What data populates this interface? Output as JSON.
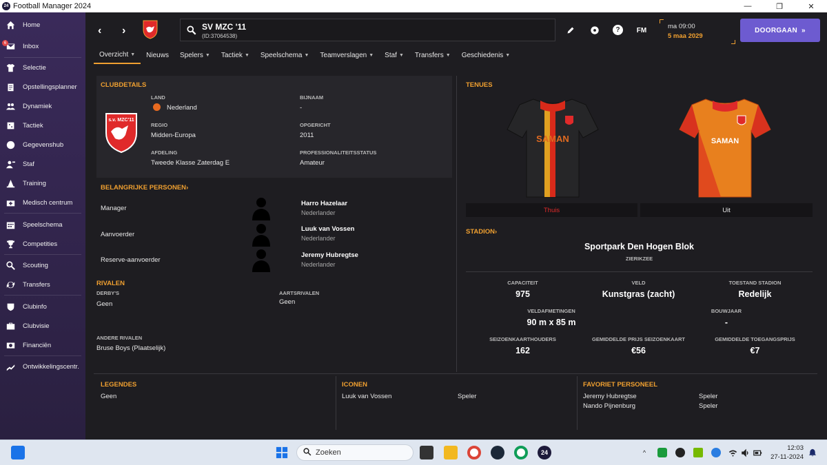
{
  "window": {
    "title": "Football Manager 2024",
    "app_icon_text": "24"
  },
  "sidebar": {
    "items": [
      {
        "label": "Home",
        "icon": "home-icon"
      },
      {
        "label": "Inbox",
        "icon": "inbox-icon",
        "badge": "6"
      },
      {
        "label": "Selectie",
        "icon": "shirt-icon"
      },
      {
        "label": "Opstellingsplanner",
        "icon": "clipboard-icon"
      },
      {
        "label": "Dynamiek",
        "icon": "people-icon"
      },
      {
        "label": "Tactiek",
        "icon": "tactics-icon"
      },
      {
        "label": "Gegevenshub",
        "icon": "data-hub-icon"
      },
      {
        "label": "Staf",
        "icon": "staff-icon"
      },
      {
        "label": "Training",
        "icon": "cone-icon"
      },
      {
        "label": "Medisch centrum",
        "icon": "medical-icon"
      },
      {
        "label": "Speelschema",
        "icon": "calendar-icon"
      },
      {
        "label": "Competities",
        "icon": "trophy-icon"
      },
      {
        "label": "Scouting",
        "icon": "binoculars-icon"
      },
      {
        "label": "Transfers",
        "icon": "transfer-icon"
      },
      {
        "label": "Clubinfo",
        "icon": "shield-icon"
      },
      {
        "label": "Clubvisie",
        "icon": "briefcase-icon"
      },
      {
        "label": "Financiën",
        "icon": "finance-icon"
      },
      {
        "label": "Ontwikkelingscentr.",
        "icon": "development-icon"
      }
    ]
  },
  "header": {
    "club_name": "SV MZC '11",
    "club_id": "(ID:37064538)",
    "time": "ma 09:00",
    "date": "5 maa 2029",
    "fm_label": "FM",
    "help_label": "?",
    "continue_label": "DOORGAAN"
  },
  "tabs": [
    {
      "label": "Overzicht",
      "chev": true
    },
    {
      "label": "Nieuws",
      "chev": false
    },
    {
      "label": "Spelers",
      "chev": true
    },
    {
      "label": "Tactiek",
      "chev": true
    },
    {
      "label": "Speelschema",
      "chev": true
    },
    {
      "label": "Teamverslagen",
      "chev": true
    },
    {
      "label": "Staf",
      "chev": true
    },
    {
      "label": "Transfers",
      "chev": true
    },
    {
      "label": "Geschiedenis",
      "chev": true
    }
  ],
  "clubdetails": {
    "title": "CLUBDETAILS",
    "crest_text": "s.v. MZC'11",
    "land_label": "LAND",
    "land_value": "Nederland",
    "bijnaam_label": "BIJNAAM",
    "bijnaam_value": "-",
    "regio_label": "REGIO",
    "regio_value": "Midden-Europa",
    "opgericht_label": "OPGERICHT",
    "opgericht_value": "2011",
    "afdeling_label": "AFDELING",
    "afdeling_value": "Tweede Klasse Zaterdag E",
    "prof_label": "PROFESSIONALITEITSSTATUS",
    "prof_value": "Amateur"
  },
  "persons": {
    "title": "BELANGRIJKE PERSONEN",
    "rows": [
      {
        "role": "Manager",
        "name": "Harro Hazelaar",
        "nation": "Nederlander"
      },
      {
        "role": "Aanvoerder",
        "name": "Luuk van Vossen",
        "nation": "Nederlander"
      },
      {
        "role": "Reserve-aanvoerder",
        "name": "Jeremy Hubregtse",
        "nation": "Nederlander"
      }
    ]
  },
  "rivals": {
    "title": "RIVALEN",
    "derbys_label": "DERBY'S",
    "derbys_value": "Geen",
    "aarts_label": "AARTSRIVALEN",
    "aarts_value": "Geen",
    "other_label": "ANDERE RIVALEN",
    "other_value": "Bruse Boys (Plaatselijk)"
  },
  "kits": {
    "title": "TENUES",
    "home_sponsor": "SAMAN",
    "away_sponsor": "SAMAN",
    "home_label": "Thuis",
    "away_label": "Uit"
  },
  "stadium": {
    "title": "STADION",
    "name": "Sportpark Den Hogen Blok",
    "city": "ZIERIKZEE",
    "stats": [
      {
        "label": "CAPACITEIT",
        "value": "975"
      },
      {
        "label": "VELD",
        "value": "Kunstgras (zacht)"
      },
      {
        "label": "TOESTAND STADION",
        "value": "Redelijk"
      },
      {
        "label": "VELDAFMETINGEN",
        "value": "90 m x 85 m"
      },
      {
        "label": "BOUWJAAR",
        "value": "-"
      },
      {
        "label": "SEIZOENKAARTHOUDERS",
        "value": "162"
      },
      {
        "label": "GEMIDDELDE PRIJS SEIZOENKAART",
        "value": "€56"
      },
      {
        "label": "GEMIDDELDE TOEGANGSPRIJS",
        "value": "€7"
      }
    ]
  },
  "legends": {
    "title": "LEGENDES",
    "value": "Geen"
  },
  "icons": {
    "title": "ICONEN",
    "rows": [
      {
        "name": "Luuk van Vossen",
        "role": "Speler"
      }
    ]
  },
  "favstaff": {
    "title": "FAVORIET PERSONEEL",
    "rows": [
      {
        "name": "Jeremy Hubregtse",
        "role": "Speler"
      },
      {
        "name": "Nando Pijnenburg",
        "role": "Speler"
      }
    ]
  },
  "taskbar": {
    "search_placeholder": "Zoeken",
    "time": "12:03",
    "date": "27-11-2024",
    "fm_icon_text": "24"
  },
  "colors": {
    "accent": "#f0a030",
    "continue": "#6d5bd0",
    "sidebar": "#3a2a5a",
    "club_red": "#e02a2a"
  }
}
